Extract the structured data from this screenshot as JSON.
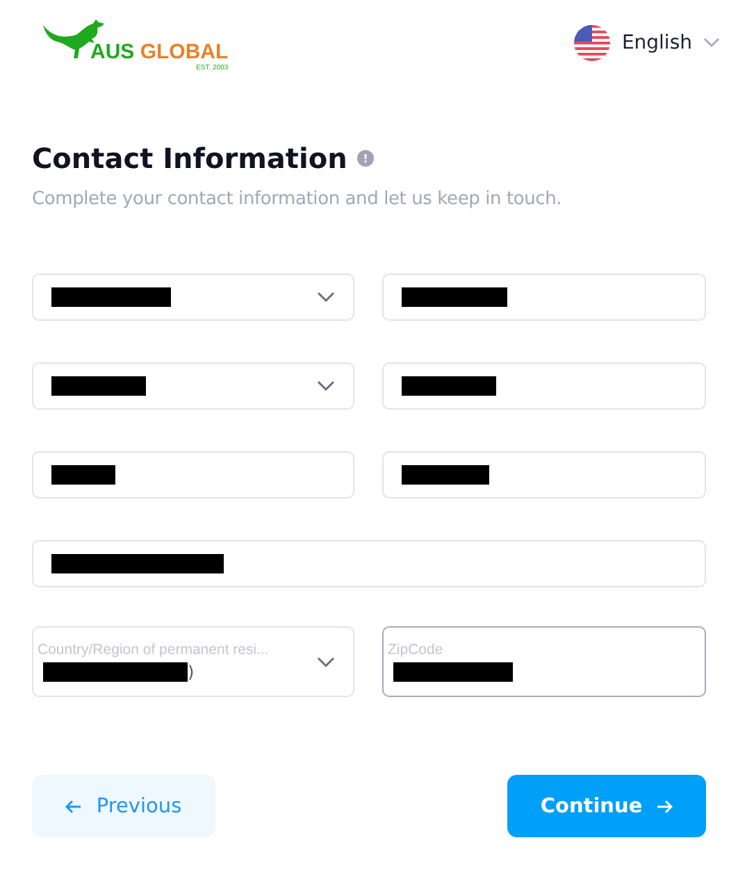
{
  "header": {
    "logo": {
      "word_1": "AUS",
      "word_2": "GLOBAL",
      "tagline": "EST. 2003"
    },
    "language": "English"
  },
  "section": {
    "title": "Contact Information",
    "subtitle": "Complete your contact information and let us keep in touch."
  },
  "fields": [
    {
      "kind": "select",
      "redacted": true
    },
    {
      "kind": "text",
      "redacted": true
    },
    {
      "kind": "select",
      "redacted": true
    },
    {
      "kind": "text",
      "redacted": true
    },
    {
      "kind": "text",
      "redacted": true
    },
    {
      "kind": "text",
      "redacted": true
    },
    {
      "kind": "text",
      "redacted": true,
      "wide": true
    },
    {
      "kind": "select",
      "redacted": true,
      "label": "Country/Region of permanent resi...",
      "value": ")"
    },
    {
      "kind": "text",
      "redacted": true,
      "label": "ZipCode",
      "focused": true
    }
  ],
  "buttons": [
    {
      "kind": "secondary",
      "label": "Previous"
    },
    {
      "kind": "primary",
      "label": "Continue"
    }
  ]
}
